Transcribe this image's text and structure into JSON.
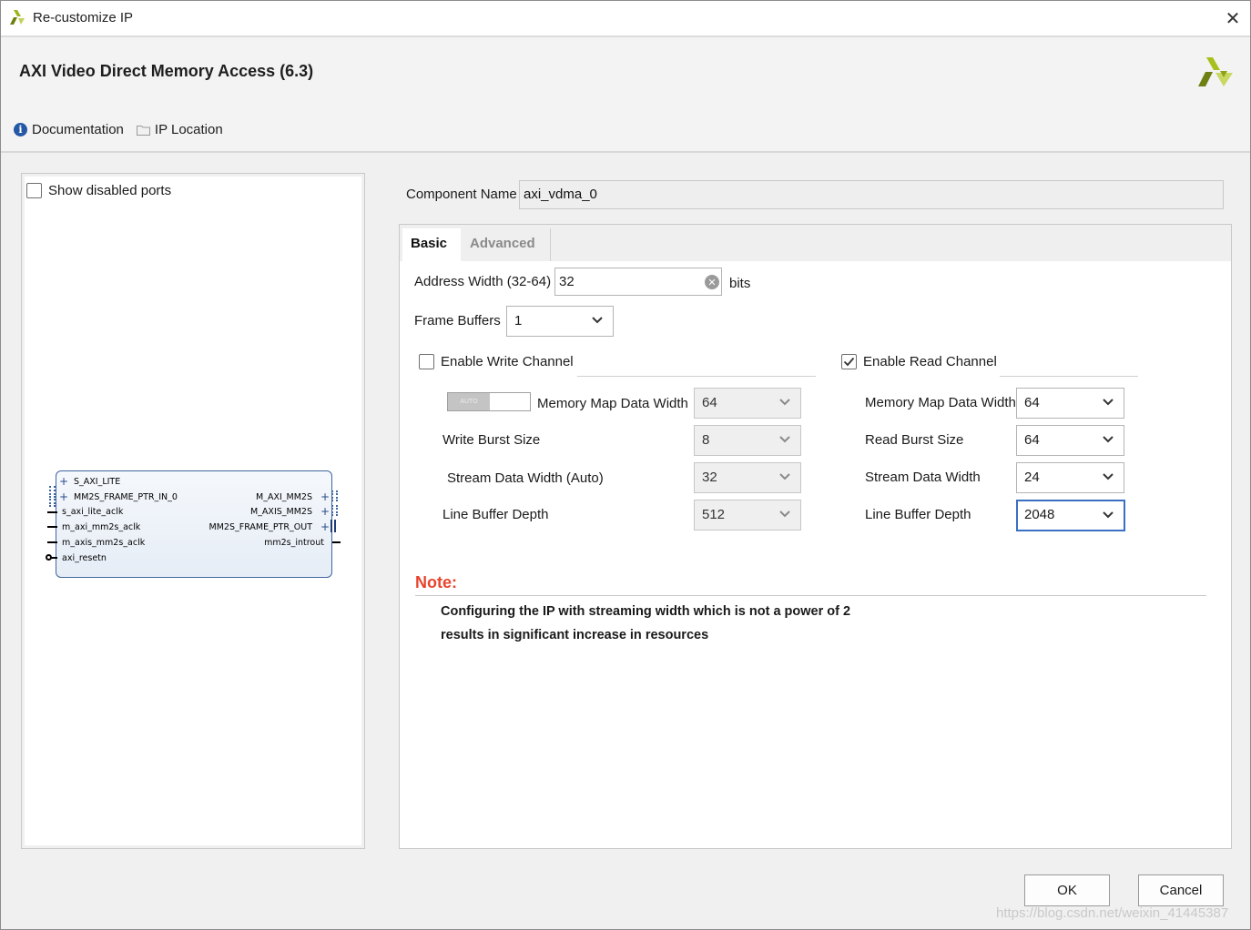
{
  "window": {
    "title": "Re-customize IP",
    "close_symbol": "✕"
  },
  "header": {
    "ip_title": "AXI Video Direct Memory Access (6.3)",
    "links": {
      "documentation": "Documentation",
      "ip_location": "IP Location"
    }
  },
  "left_panel": {
    "show_disabled_ports": {
      "label": "Show disabled ports",
      "checked": false
    },
    "symbol": {
      "left_ports": [
        "S_AXI_LITE",
        "MM2S_FRAME_PTR_IN_0",
        "s_axi_lite_aclk",
        "m_axi_mm2s_aclk",
        "m_axis_mm2s_aclk",
        "axi_resetn"
      ],
      "right_ports": [
        "M_AXI_MM2S",
        "M_AXIS_MM2S",
        "MM2S_FRAME_PTR_OUT",
        "mm2s_introut"
      ]
    }
  },
  "main": {
    "component_name": {
      "label": "Component Name",
      "value": "axi_vdma_0"
    },
    "tabs": [
      {
        "label": "Basic",
        "active": true
      },
      {
        "label": "Advanced",
        "active": false
      }
    ],
    "basic": {
      "address_width": {
        "label": "Address Width (32-64)",
        "value": "32",
        "unit": "bits"
      },
      "frame_buffers": {
        "label": "Frame Buffers",
        "value": "1"
      },
      "write_channel": {
        "label": "Enable Write Channel",
        "checked": false,
        "auto_label": "AUTO",
        "memory_map_data_width": {
          "label": "Memory Map Data Width",
          "value": "64"
        },
        "burst_size": {
          "label": "Write Burst Size",
          "value": "8"
        },
        "stream_data_width": {
          "label": "Stream Data Width (Auto)",
          "value": "32"
        },
        "line_buffer_depth": {
          "label": "Line Buffer Depth",
          "value": "512"
        }
      },
      "read_channel": {
        "label": "Enable Read Channel",
        "checked": true,
        "memory_map_data_width": {
          "label": "Memory Map Data Width",
          "value": "64"
        },
        "burst_size": {
          "label": "Read Burst Size",
          "value": "64"
        },
        "stream_data_width": {
          "label": "Stream Data Width",
          "value": "24"
        },
        "line_buffer_depth": {
          "label": "Line Buffer Depth",
          "value": "2048"
        }
      },
      "note": {
        "title": "Note:",
        "line1": "Configuring the IP with streaming width which is not a power of 2",
        "line2": "results in significant increase in resources"
      }
    }
  },
  "footer": {
    "ok_label": "OK",
    "cancel_label": "Cancel",
    "watermark": "https://blog.csdn.net/weixin_41445387"
  },
  "colors": {
    "note_title": "#e8442e",
    "focus_border": "#3a6fc4",
    "brand_green": "#9cb31b",
    "info_blue": "#2557a7"
  },
  "icons": [
    "xilinx-logo-icon",
    "close-icon",
    "info-icon",
    "folder-icon",
    "clear-icon",
    "chevron-down-icon",
    "checkmark-icon"
  ]
}
